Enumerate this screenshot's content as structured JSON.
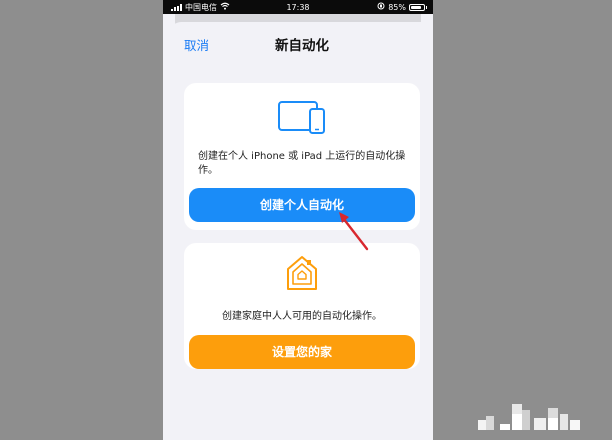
{
  "status_bar": {
    "carrier": "中国电信",
    "time": "17:38",
    "battery": "85%",
    "battery_level": 0.85
  },
  "nav": {
    "cancel_label": "取消",
    "title": "新自动化"
  },
  "personal": {
    "icon": "iphone-ipad-icon",
    "description": "创建在个人 iPhone 或 iPad 上运行的自动化操作。",
    "button_label": "创建个人自动化"
  },
  "home": {
    "icon": "home-icon",
    "description": "创建家庭中人人可用的自动化操作。",
    "button_label": "设置您的家"
  },
  "colors": {
    "accent_blue": "#1a8cf8",
    "accent_orange": "#fd9e0c",
    "link_blue": "#1a7cf5",
    "annotation_red": "#d8282f"
  }
}
